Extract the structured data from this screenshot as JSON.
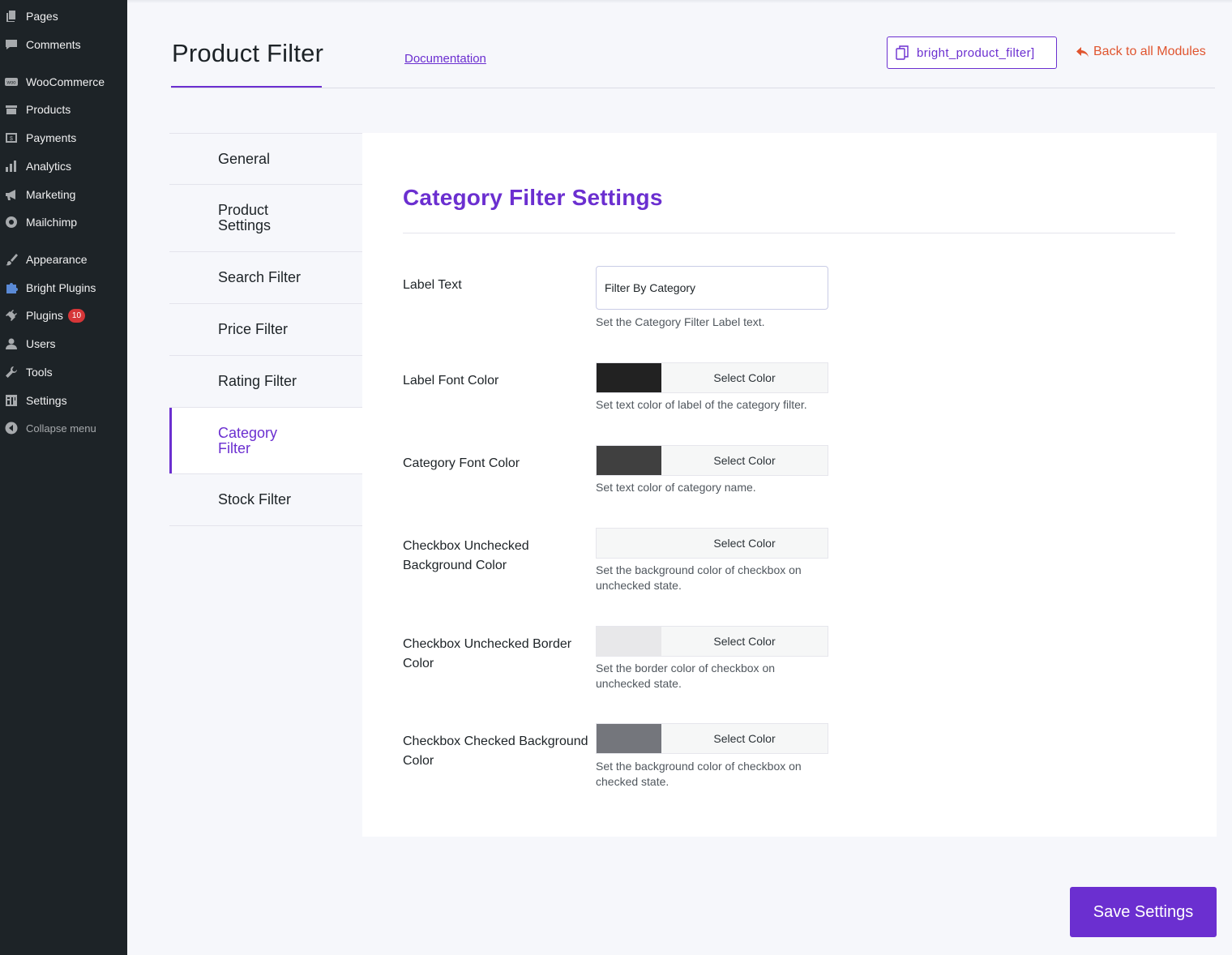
{
  "sidebar": {
    "items": [
      {
        "label": "Pages",
        "icon": "pages-icon"
      },
      {
        "label": "Comments",
        "icon": "comments-icon"
      },
      {
        "label": "WooCommerce",
        "icon": "woocommerce-icon"
      },
      {
        "label": "Products",
        "icon": "products-icon"
      },
      {
        "label": "Payments",
        "icon": "payments-icon"
      },
      {
        "label": "Analytics",
        "icon": "analytics-icon"
      },
      {
        "label": "Marketing",
        "icon": "megaphone-icon"
      },
      {
        "label": "Mailchimp",
        "icon": "mailchimp-icon"
      },
      {
        "label": "Appearance",
        "icon": "paintbrush-icon"
      },
      {
        "label": "Bright Plugins",
        "icon": "puzzle-icon"
      },
      {
        "label": "Plugins",
        "icon": "plug-icon",
        "badge": "10"
      },
      {
        "label": "Users",
        "icon": "users-icon"
      },
      {
        "label": "Tools",
        "icon": "wrench-icon"
      },
      {
        "label": "Settings",
        "icon": "settings-icon"
      },
      {
        "label": "Collapse menu",
        "icon": "collapse-icon"
      }
    ]
  },
  "header": {
    "title": "Product Filter",
    "doc_link": "Documentation",
    "shortcode": "bright_product_filter]",
    "back_link": "Back to all Modules"
  },
  "tabs": [
    {
      "label": "General"
    },
    {
      "label": "Product Settings"
    },
    {
      "label": "Search Filter"
    },
    {
      "label": "Price Filter"
    },
    {
      "label": "Rating Filter"
    },
    {
      "label": "Category Filter",
      "active": true
    },
    {
      "label": "Stock Filter"
    }
  ],
  "panel": {
    "title": "Category Filter Settings",
    "label_text": {
      "label": "Label Text",
      "value": "Filter By Category",
      "description": "Set the Category Filter Label text."
    },
    "color_fields": [
      {
        "label": "Label Font Color",
        "button": "Select Color",
        "color": "#222222",
        "description": "Set text color of label of the category filter."
      },
      {
        "label": "Category Font Color",
        "button": "Select Color",
        "color": "#404040",
        "description": "Set text color of category name."
      },
      {
        "label": "Checkbox Unchecked Background Color",
        "button": "Select Color",
        "color": "#f6f7f7",
        "description": "Set the background color of checkbox on unchecked state."
      },
      {
        "label": "Checkbox Unchecked Border Color",
        "button": "Select Color",
        "color": "#e8e8ea",
        "description": "Set the border color of checkbox on unchecked state."
      },
      {
        "label": "Checkbox Checked Background Color",
        "button": "Select Color",
        "color": "#74767c",
        "description": "Set the background color of checkbox on checked state."
      }
    ]
  },
  "save_button": "Save Settings",
  "colors": {
    "accent": "#6b2fd0",
    "back_link": "#e0552f",
    "sidebar_bg": "#1d2327",
    "badge": "#d63638"
  }
}
